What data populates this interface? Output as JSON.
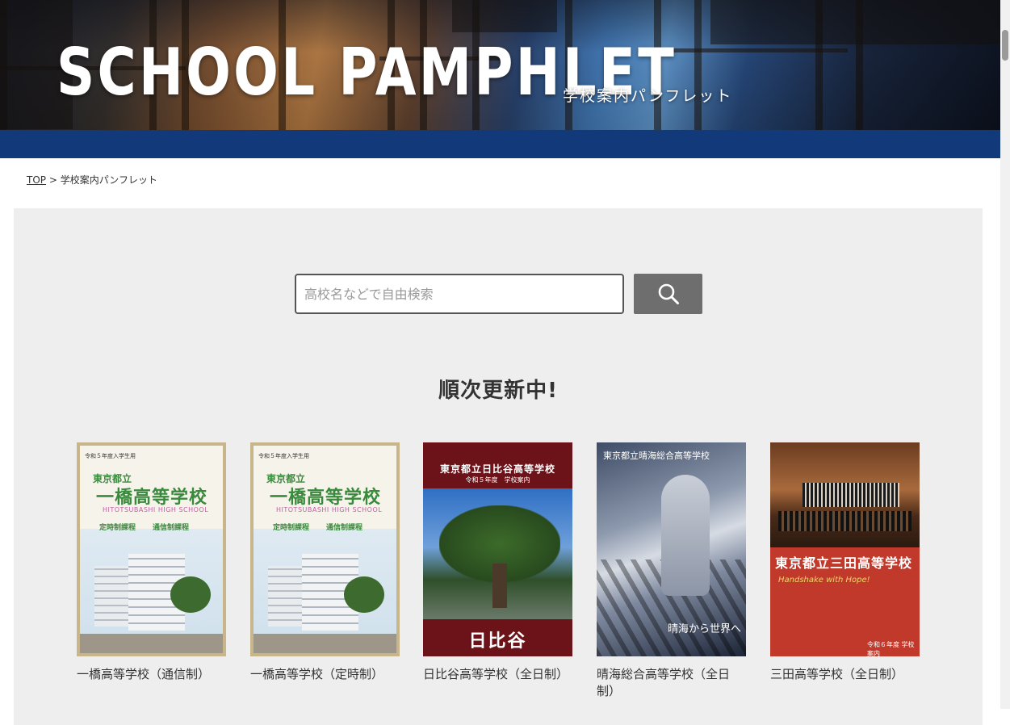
{
  "hero": {
    "title": "SCHOOL PAMPHLET",
    "subtitle": "学校案内パンフレット"
  },
  "breadcrumb": {
    "top_link": "TOP",
    "separator": " > ",
    "current": "学校案内パンフレット"
  },
  "search": {
    "placeholder": "高校名などで自由検索",
    "value": "",
    "button_icon": "search-icon"
  },
  "section": {
    "heading": "順次更新中!"
  },
  "pamphlets": [
    {
      "label": "一橋高等学校（通信制）",
      "cover": {
        "top_note": "令和５年度入学生用",
        "name_small": "東京都立",
        "name_large": "一橋高等学校",
        "name_en": "HITOTSUBASHI HIGH SCHOOL",
        "course_a": "定時制課程",
        "course_b": "通信制課程"
      }
    },
    {
      "label": "一橋高等学校（定時制）",
      "cover": {
        "top_note": "令和５年度入学生用",
        "name_small": "東京都立",
        "name_large": "一橋高等学校",
        "name_en": "HITOTSUBASHI HIGH SCHOOL",
        "course_a": "定時制課程",
        "course_b": "通信制課程"
      }
    },
    {
      "label": "日比谷高等学校（全日制）",
      "cover": {
        "title": "東京都立日比谷高等学校",
        "subtitle": "令和５年度　学校案内",
        "bottom": "日比谷"
      }
    },
    {
      "label": "晴海総合高等学校（全日制）",
      "cover": {
        "title": "東京都立晴海総合高等学校",
        "tagline": "晴海から世界へ"
      }
    },
    {
      "label": "三田高等学校（全日制）",
      "cover": {
        "title": "東京都立三田高等学校",
        "tagline": "Handshake with Hope!",
        "footer": "令和６年度 学校案内"
      }
    }
  ]
}
